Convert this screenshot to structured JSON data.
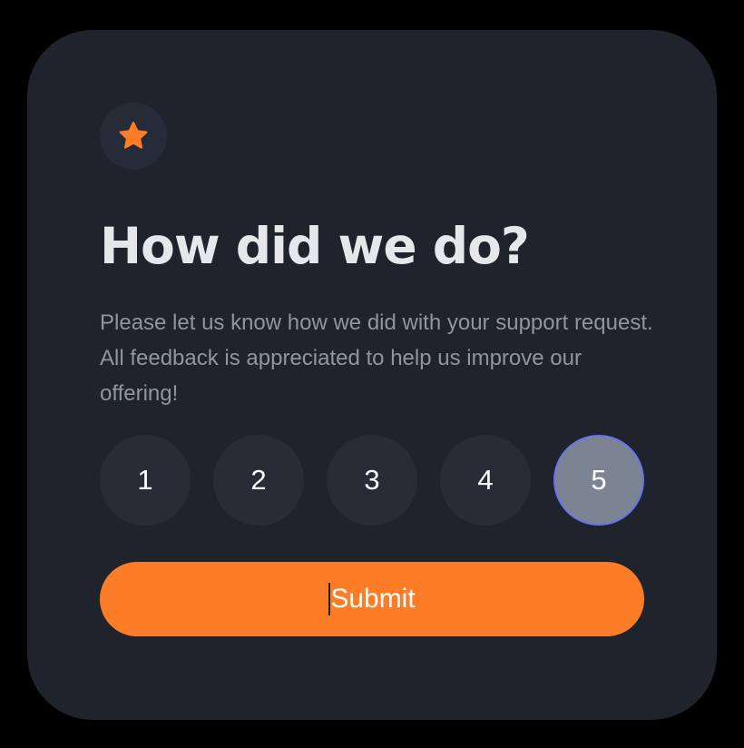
{
  "colors": {
    "page_background": "#000000",
    "card_background": "#1f232c",
    "accent": "#fc7c27",
    "selected_ring": "#6b72f0",
    "selected_fill": "#7c8494",
    "title_text": "#e6e7ea",
    "body_text": "#8f95a1"
  },
  "icon": {
    "name": "star-icon"
  },
  "card": {
    "title": "How did we do?",
    "description": "Please let us know how we did with your support request. All feedback is appreciated to help us improve our offering!"
  },
  "rating": {
    "options": [
      "1",
      "2",
      "3",
      "4",
      "5"
    ],
    "selected": "5"
  },
  "submit": {
    "label": "Submit"
  }
}
